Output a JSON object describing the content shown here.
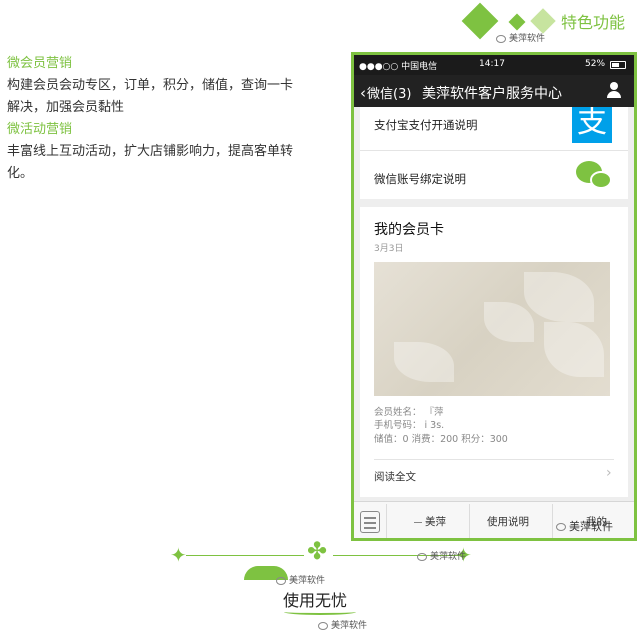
{
  "header": {
    "title": "特色功能",
    "watermark": "美萍软件"
  },
  "left_text": {
    "section1_title": "微会员营销",
    "section1_line1": "构建会员会动专区，订单，积分，储值，查询一卡",
    "section1_line2": "解决，加强会员黏性",
    "section2_title": "微活动营销",
    "section2_line1": "丰富线上互动活动，扩大店铺影响力，提高客单转",
    "section2_line2": "化。"
  },
  "phone": {
    "status": {
      "carrier": "●●●○○ 中国电信",
      "time": "14:17",
      "battery": "52%"
    },
    "nav": {
      "back_label": "微信(3)",
      "title": "美萍软件客户服务中心"
    },
    "rows": [
      {
        "label": "支付宝支付开通说明",
        "icon": "alipay-icon"
      },
      {
        "label": "微信账号绑定说明",
        "icon": "wechat-icon"
      }
    ],
    "card": {
      "title": "我的会员卡",
      "date": "3月3日",
      "name_line": "会员姓名：    『萍",
      "phone_line": "手机号码：    i     3s.",
      "balance_line": "储值：0  消费：200  积分：300",
      "read_more": "阅读全文"
    },
    "bottom_bar": {
      "item1": "美萍",
      "item2": "使用说明",
      "item3": "我的"
    }
  },
  "footer": {
    "title": "使用无忧",
    "watermark": "美萍软件"
  },
  "colors": {
    "accent": "#7ec241",
    "alipay": "#00a0e9",
    "nav_bg": "#222222"
  }
}
